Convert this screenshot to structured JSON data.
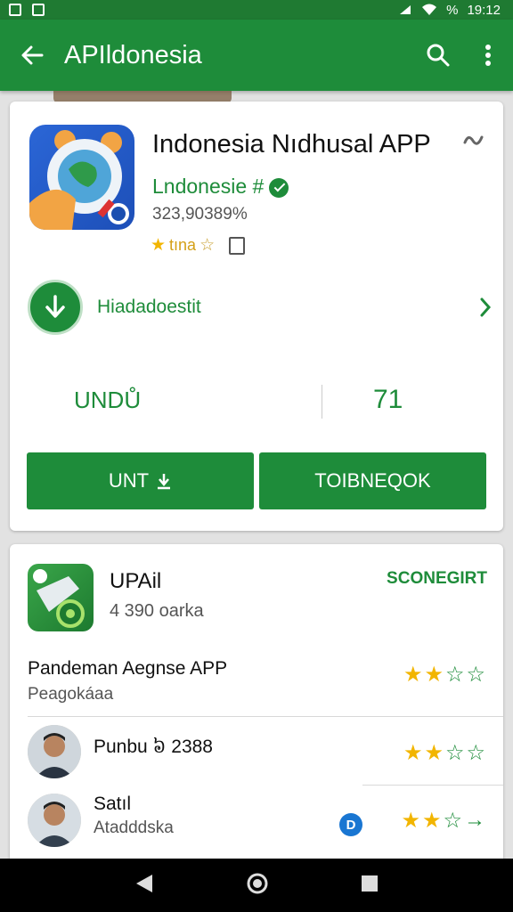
{
  "status_bar": {
    "time": "19:12",
    "battery": "%"
  },
  "appbar": {
    "title": "APIldonesia"
  },
  "app": {
    "title": "Indonesia Nıdhusal APP",
    "developer": "Lndonesie #",
    "downloads": "323,90389%",
    "rating_label": "tına"
  },
  "install": {
    "label": "Hiadadoestit"
  },
  "stats": {
    "left": "UNDŮ",
    "right": "71"
  },
  "buttons": {
    "left": "UNT",
    "right": "TOIBNEQOK"
  },
  "section": {
    "title": "UPAil",
    "meta": "4 390 oarka",
    "see_all": "SCONEGIRT"
  },
  "reviews": [
    {
      "name": "Pandeman Aegnse APP",
      "sub": "Peagokáaa",
      "stars": 2
    },
    {
      "name": "Punbu ៦ 2388",
      "sub": "",
      "stars": 2
    },
    {
      "name": "Satıl",
      "sub": "Atadddska",
      "stars": 2,
      "badge": "D"
    }
  ],
  "colors": {
    "primary": "#1e8c3a",
    "star": "#f2b500",
    "status": "#1f7a32"
  }
}
